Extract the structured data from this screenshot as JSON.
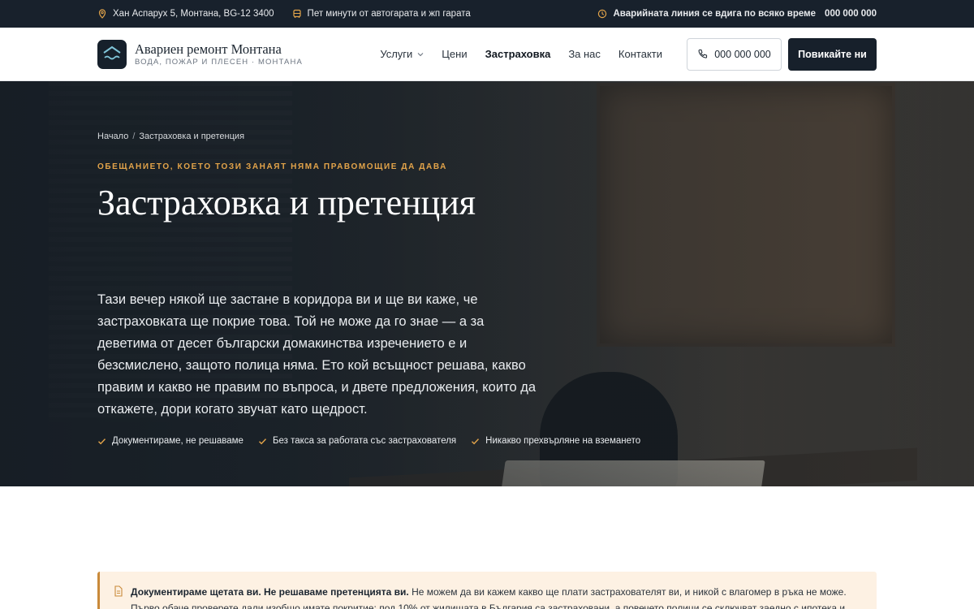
{
  "topbar": {
    "address": "Хан Аспарух 5, Монтана, BG-12 3400",
    "transit": "Пет минути от автогарата и жп гарата",
    "emergency_label": "Аварийната линия се вдига по всяко време",
    "emergency_number": "000 000 000",
    "icons": [
      "map-pin-icon",
      "bus-icon",
      "clock-icon"
    ]
  },
  "header": {
    "brand_name": "Авариен ремонт Монтана",
    "brand_sub": "ВОДА, ПОЖАР И ПЛЕСЕН · МОНТАНА",
    "nav": [
      {
        "label": "Услуги",
        "has_dropdown": true
      },
      {
        "label": "Цени"
      },
      {
        "label": "Застраховка",
        "active": true
      },
      {
        "label": "За нас"
      },
      {
        "label": "Контакти"
      }
    ],
    "phone_button": "000 000 000",
    "call_button": "Повикайте ни"
  },
  "hero": {
    "breadcrumb": [
      "Начало",
      "Застраховка и претенция"
    ],
    "eyebrow": "ОБЕЩАНИЕТО, КОЕТО ТОЗИ ЗАНАЯТ НЯМА ПРАВОМОЩИЕ ДА ДАВА",
    "title": "Застраховка и претенция",
    "lead": "Тази вечер някой ще застане в коридора ви и ще ви каже, че застраховката ще покрие това. Той не може да го знае — а за деветима от десет български домакинства изречението е и безсмислено, защото полица няма. Ето кой всъщност решава, какво правим и какво не правим по въпроса, и двете предложения, които да откажете, дори когато звучат като щедрост.",
    "checks": [
      "Документираме, не решаваме",
      "Без такса за работата със застрахователя",
      "Никакво прехвърляне на вземането"
    ]
  },
  "notice": {
    "bold": "Документираме щетата ви. Не решаваме претенцията ви.",
    "text": " Не можем да ви кажем какво ще плати застрахователят ви, и никой с влагомер в ръка не може. Първо обаче проверете дали изобщо имате покритие: под 10% от жилищата в България са застраховани, а повечето полици се сключват заедно с ипотека и хората забравят"
  },
  "colors": {
    "dark": "#18212c",
    "accent": "#e3a44a",
    "notice_bg": "#fdf1e3",
    "notice_border": "#c98a3a"
  }
}
